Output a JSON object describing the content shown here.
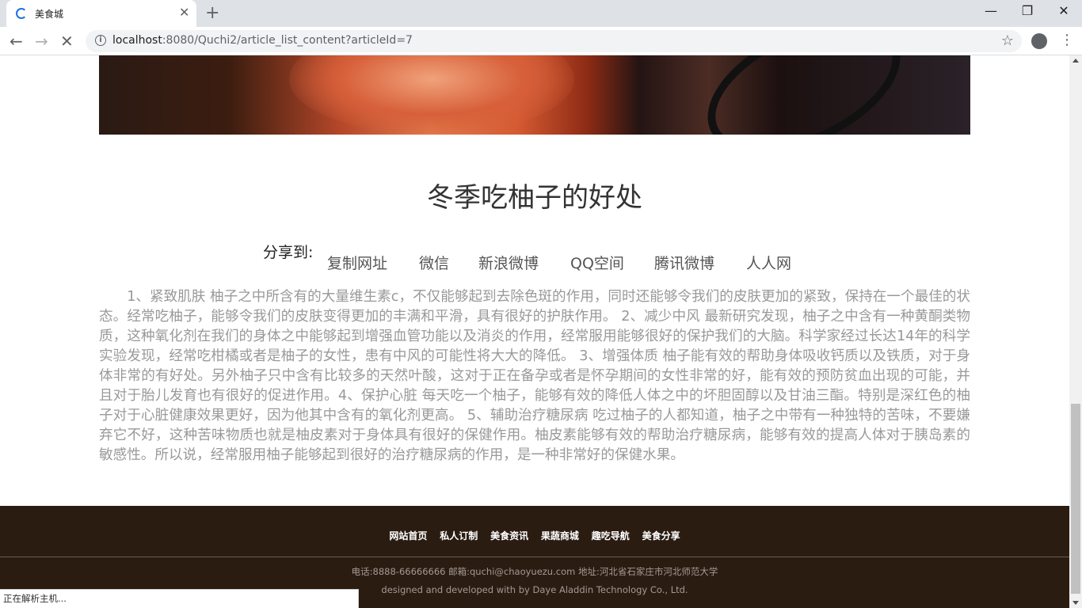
{
  "browser": {
    "tab_title": "美食城",
    "url_host": "localhost",
    "url_rest": ":8080/Quchi2/article_list_content?articleId=7",
    "status_text": "正在解析主机..."
  },
  "article": {
    "title": "冬季吃柚子的好处",
    "share_label": "分享到:",
    "share_links": [
      "复制网址",
      "微信",
      "新浪微博",
      "QQ空间",
      "腾讯微博",
      "人人网"
    ],
    "body": "1、紧致肌肤 柚子之中所含有的大量维生素c，不仅能够起到去除色斑的作用，同时还能够令我们的皮肤更加的紧致，保持在一个最佳的状态。经常吃柚子，能够令我们的皮肤变得更加的丰满和平滑，具有很好的护肤作用。 2、减少中风 最新研究发现，柚子之中含有一种黄酮类物质，这种氧化剂在我们的身体之中能够起到增强血管功能以及消炎的作用，经常服用能够很好的保护我们的大脑。科学家经过长达14年的科学实验发现，经常吃柑橘或者是柚子的女性，患有中风的可能性将大大的降低。 3、增强体质 柚子能有效的帮助身体吸收钙质以及铁质，对于身体非常的有好处。另外柚子只中含有比较多的天然叶酸，这对于正在备孕或者是怀孕期间的女性非常的好，能有效的预防贫血出现的可能，并且对于胎儿发育也有很好的促进作用。4、保护心脏 每天吃一个柚子，能够有效的降低人体之中的坏胆固醇以及甘油三酯。特别是深红色的柚子对于心脏健康效果更好，因为他其中含有的氧化剂更高。 5、辅助治疗糖尿病 吃过柚子的人都知道，柚子之中带有一种独特的苦味，不要嫌弃它不好，这种苦味物质也就是柚皮素对于身体具有很好的保健作用。柚皮素能够有效的帮助治疗糖尿病，能够有效的提高人体对于胰岛素的敏感性。所以说，经常服用柚子能够起到很好的治疗糖尿病的作用，是一种非常好的保健水果。"
  },
  "footer": {
    "nav": [
      "网站首页",
      "私人订制",
      "美食资讯",
      "果蔬商城",
      "趣吃导航",
      "美食分享"
    ],
    "contact": "电话:8888-66666666 邮箱:quchi@chaoyuezu.com 地址:河北省石家庄市河北师范大学",
    "credit": "designed and developed with by Daye Aladdin Technology Co., Ltd."
  }
}
